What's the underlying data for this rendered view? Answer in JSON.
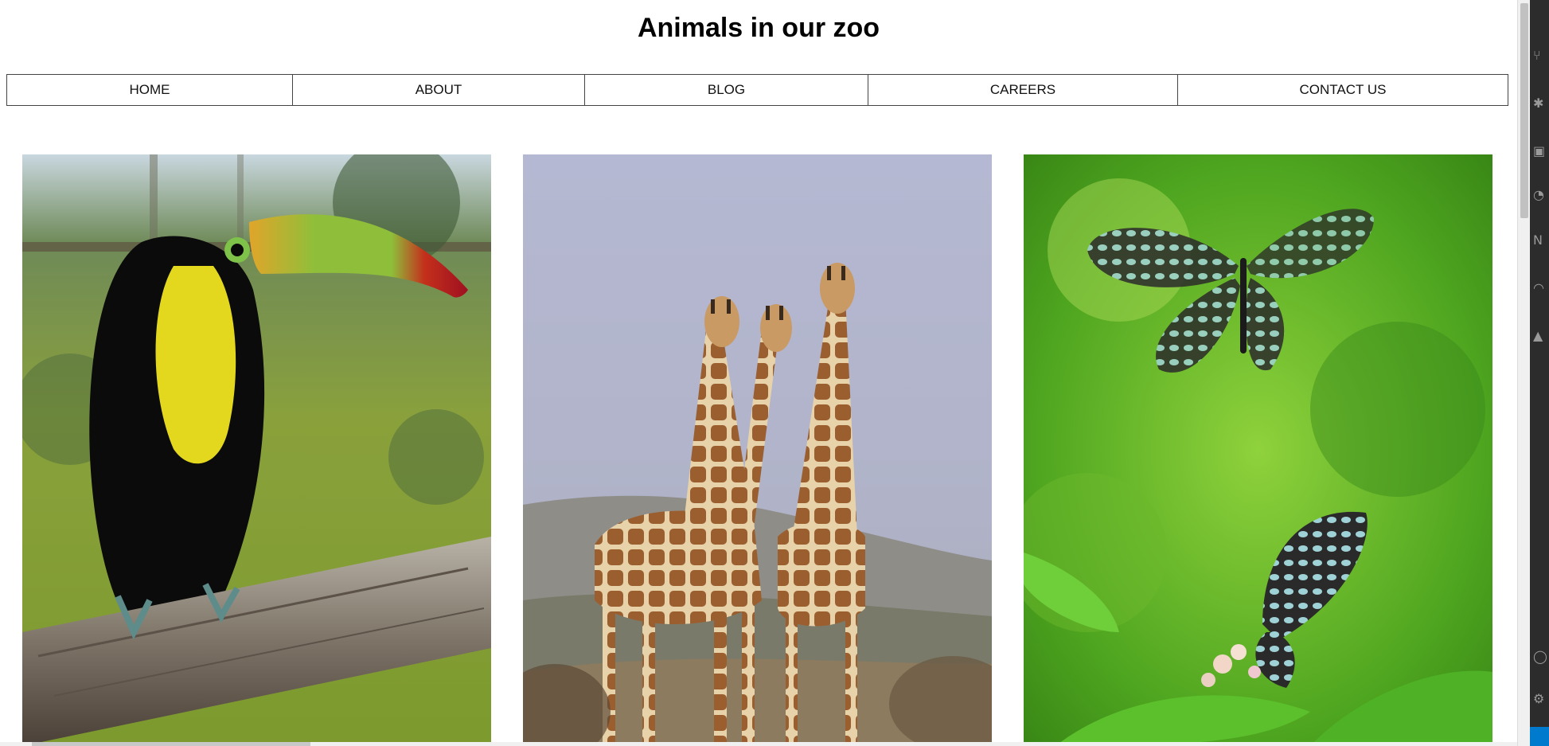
{
  "page": {
    "title": "Animals in our zoo"
  },
  "nav": {
    "items": [
      {
        "label": "HOME",
        "name": "nav-home"
      },
      {
        "label": "ABOUT",
        "name": "nav-about"
      },
      {
        "label": "BLOG",
        "name": "nav-blog"
      },
      {
        "label": "CAREERS",
        "name": "nav-careers"
      },
      {
        "label": "CONTACT US",
        "name": "nav-contact-us"
      }
    ]
  },
  "gallery": {
    "photos": [
      {
        "subject": "toucan"
      },
      {
        "subject": "giraffes"
      },
      {
        "subject": "butterflies"
      }
    ]
  },
  "colors": {
    "nav_border": "#444444",
    "side_bar": "#2c2c2c",
    "accent": "#007acc"
  },
  "side_icons": [
    "source-control-icon",
    "debug-icon",
    "extensions-icon",
    "info-icon",
    "note-icon",
    "remote-icon",
    "triangle-icon",
    "account-icon",
    "settings-icon"
  ]
}
